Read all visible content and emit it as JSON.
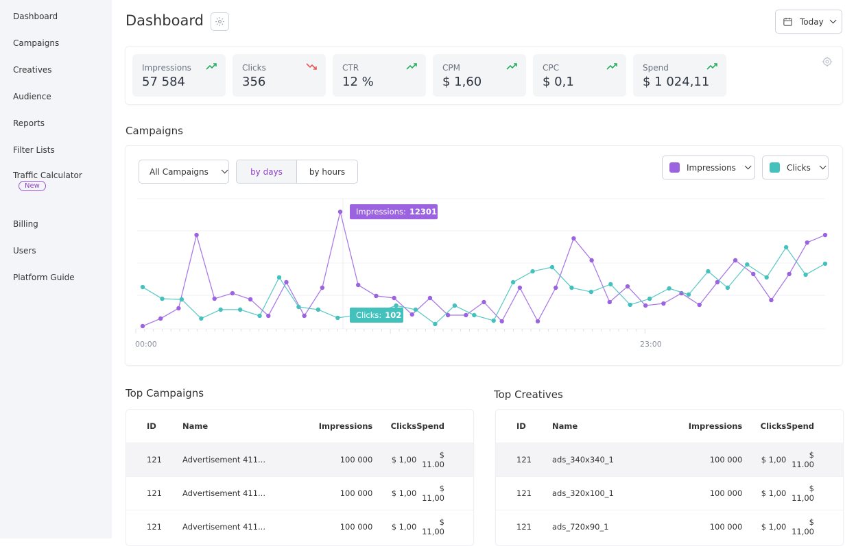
{
  "sidebar": {
    "items": [
      {
        "label": "Dashboard"
      },
      {
        "label": "Campaigns"
      },
      {
        "label": "Creatives"
      },
      {
        "label": "Audience"
      },
      {
        "label": "Reports"
      },
      {
        "label": "Filter Lists"
      },
      {
        "label": "Traffic Calculator",
        "badge": "New"
      },
      {
        "label": "Billing"
      },
      {
        "label": "Users"
      },
      {
        "label": "Platform Guide"
      }
    ]
  },
  "header": {
    "title": "Dashboard",
    "date_range": "Today"
  },
  "kpis": [
    {
      "label": "Impressions",
      "value": "57 584",
      "trend": "up"
    },
    {
      "label": "Clicks",
      "value": "356",
      "trend": "down"
    },
    {
      "label": "CTR",
      "value": "12 %",
      "trend": "up"
    },
    {
      "label": "CPM",
      "value": "$ 1,60",
      "trend": "up"
    },
    {
      "label": "CPC",
      "value": "$ 0,1",
      "trend": "up"
    },
    {
      "label": "Spend",
      "value": "$ 1 024,11",
      "trend": "up"
    }
  ],
  "colors": {
    "up": "#27ae60",
    "down": "#eb5757",
    "impressions": "#9b63e0",
    "clicks": "#45c1bd",
    "accent": "#8e3fc9"
  },
  "campaigns": {
    "title": "Campaigns",
    "filter": "All Campaigns",
    "tabs": [
      {
        "label": "by days",
        "active": true
      },
      {
        "label": "by hours",
        "active": false
      }
    ],
    "metric1": "Impressions",
    "metric2": "Clicks"
  },
  "chart_data": {
    "type": "line",
    "x_tick_labels": [
      "00:00",
      "23:00"
    ],
    "grid": true,
    "series": [
      {
        "name": "Impressions",
        "color": "#9b63e0",
        "values": [
          290,
          1080,
          2160,
          9860,
          3170,
          3740,
          3100,
          1370,
          4900,
          1370,
          4320,
          12301,
          4610,
          3460,
          3240,
          1510,
          3240,
          1440,
          1440,
          2810,
          790,
          4320,
          790,
          4320,
          9500,
          7200,
          2810,
          4460,
          2450,
          2660,
          3740,
          2520,
          4900,
          7200,
          5760,
          3020,
          5760,
          9070,
          9860
        ],
        "tooltip": {
          "label": "Impressions:",
          "value": "12301",
          "index": 11
        }
      },
      {
        "name": "Clicks",
        "color": "#45c1bd",
        "values": [
          311,
          224,
          219,
          77,
          143,
          143,
          97,
          383,
          163,
          143,
          82,
          102,
          122,
          173,
          143,
          36,
          173,
          102,
          61,
          347,
          428,
          459,
          306,
          275,
          332,
          179,
          224,
          301,
          255,
          428,
          306,
          479,
          383,
          607,
          403,
          485
        ],
        "tooltip": {
          "label": "Clicks:",
          "value": "102",
          "index": 11
        }
      }
    ]
  },
  "top_campaigns": {
    "title": "Top Campaigns",
    "columns": [
      "ID",
      "Name",
      "Impressions",
      "Clicks",
      "Spend"
    ],
    "rows": [
      [
        "121",
        "Advertisement 411...",
        "100 000",
        "$ 1,00",
        "$ 11.00"
      ],
      [
        "121",
        "Advertisement 411...",
        "100 000",
        "$ 1,00",
        "$ 11,00"
      ],
      [
        "121",
        "Advertisement 411...",
        "100 000",
        "$ 1,00",
        "$ 11,00"
      ]
    ]
  },
  "top_creatives": {
    "title": "Top Creatives",
    "columns": [
      "ID",
      "Name",
      "Impressions",
      "Clicks",
      "Spend"
    ],
    "rows": [
      [
        "121",
        "ads_340x340_1",
        "100 000",
        "$ 1,00",
        "$ 11.00"
      ],
      [
        "121",
        "ads_320x100_1",
        "100 000",
        "$ 1,00",
        "$ 11,00"
      ],
      [
        "121",
        "ads_720x90_1",
        "100 000",
        "$ 1,00",
        "$ 11,00"
      ]
    ]
  }
}
